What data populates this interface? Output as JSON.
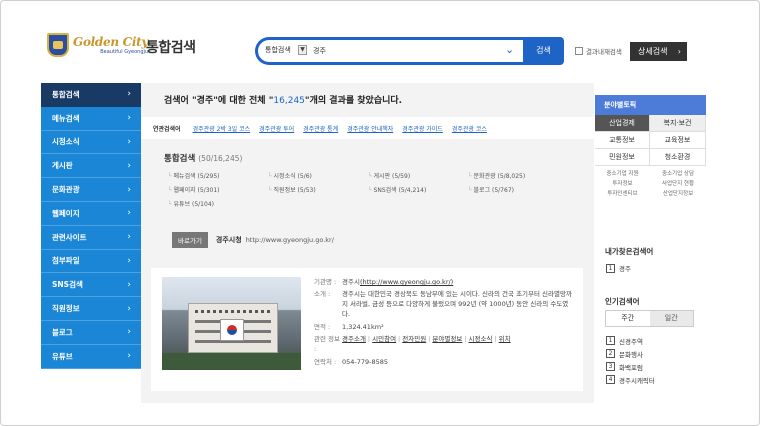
{
  "header": {
    "logo_title": "Golden City",
    "logo_sub": "Beautiful Gyeongju",
    "site_title": "통합검색",
    "scope": "통합검색",
    "scope_arrow": "▼",
    "query": "경주",
    "search_button": "검색",
    "within_results": "결과내재검색",
    "detail_search": "상세검색",
    "detail_arrow": "›"
  },
  "nav": {
    "items": [
      {
        "label": "통합검색",
        "active": true
      },
      {
        "label": "메뉴검색"
      },
      {
        "label": "시정소식"
      },
      {
        "label": "게시판"
      },
      {
        "label": "문화관광"
      },
      {
        "label": "웹페이지"
      },
      {
        "label": "관련사이트"
      },
      {
        "label": "첨부파일"
      },
      {
        "label": "SNS검색"
      },
      {
        "label": "직원정보"
      },
      {
        "label": "블로그"
      },
      {
        "label": "유튜브"
      }
    ],
    "chevron": "›"
  },
  "result": {
    "prefix": "검색어 \"경주\"에 대한 전체 \"",
    "count": "16,245",
    "suffix": "\"개의 결과를 찾았습니다."
  },
  "related": {
    "label": "연관검색어",
    "links": [
      "경주관광 2박 3일 코스",
      "경주관광 투어",
      "경주관광 통계",
      "경주관광 안내책자",
      "경주관광 가이드",
      "경주관광 코스"
    ]
  },
  "integrated": {
    "title": "통합검색",
    "count": "(50/16,245)",
    "categories": [
      "메뉴검색 (5/295)",
      "시정소식 (5/6)",
      "게시판 (5/59)",
      "문화관광 (5/8,025)",
      "웹페이지 (5/301)",
      "직원정보 (5/53)",
      "SNS검색 (5/4,214)",
      "블로그 (5/767)",
      "유튜브 (5/104)"
    ]
  },
  "goto": {
    "badge": "바로가기",
    "name": "경주시청",
    "url": "http://www.gyeongju.go.kr/"
  },
  "card": {
    "agency_key": "기관명 :",
    "agency_name": "경주시",
    "agency_url": "(http://www.gyeongju.go.kr/)",
    "intro_key": "소개 :",
    "intro": "경주시는 대한민국 경상북도 동남부에 있는 시이다. 신라의 건국 초기부터 신라멸망까지 서라벌, 금성 등으로 다양하게 불렀으며 992년 (약 1000년) 동안 신라의 수도였다.",
    "area_key": "면적 :",
    "area": "1,324.41km²",
    "links_key": "관련 정보 :",
    "links": [
      "경주소개",
      "시민참여",
      "전자민원",
      "분야별정보",
      "시정소식",
      "위치"
    ],
    "phone_key": "연락처 :",
    "phone": "054-779-8585"
  },
  "topics": {
    "title": "분야별토픽",
    "items": [
      {
        "label": "산업경제",
        "selected": true
      },
      {
        "label": "복지·보건"
      },
      {
        "label": "교통정보"
      },
      {
        "label": "교육정보"
      },
      {
        "label": "민원정보"
      },
      {
        "label": "청소환경"
      }
    ],
    "sub_items": [
      "중소기업 지원",
      "중소기업 상담",
      "투자정보",
      "사업단지 현황",
      "투자인센티브",
      "산업단지정보"
    ]
  },
  "frequent": {
    "title": "내가찾은검색어",
    "items": [
      {
        "rank": "1",
        "label": "경주"
      }
    ]
  },
  "popular": {
    "title": "인기검색어",
    "tabs": [
      "주간",
      "일간"
    ],
    "items": [
      {
        "rank": "1",
        "label": "신경주역"
      },
      {
        "rank": "2",
        "label": "문화행사"
      },
      {
        "rank": "3",
        "label": "화백포럼"
      },
      {
        "rank": "4",
        "label": "경주시캐릭터"
      }
    ]
  }
}
